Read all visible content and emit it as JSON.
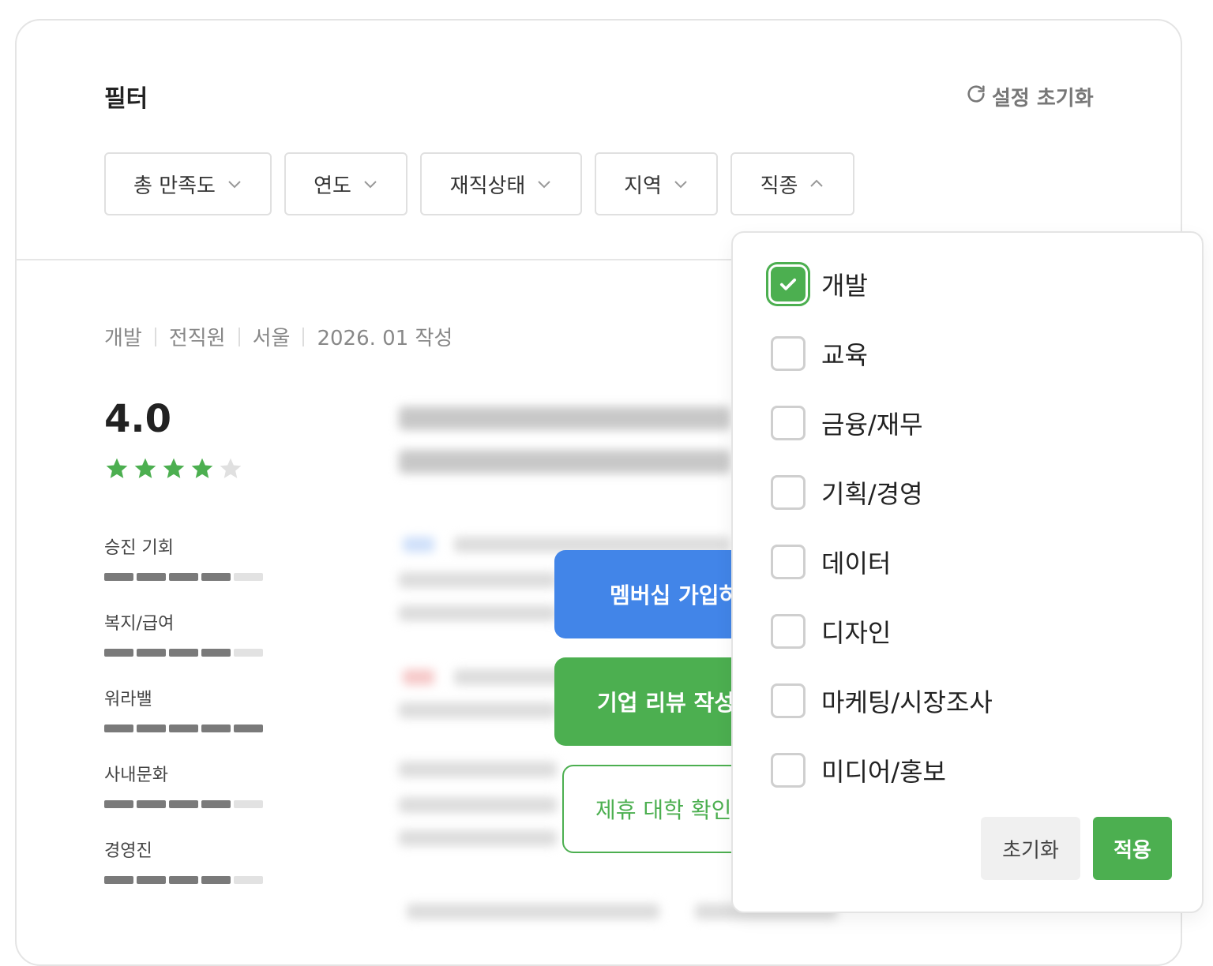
{
  "filter": {
    "title": "필터",
    "reset_label": "설정 초기화",
    "chips": [
      {
        "label": "총 만족도"
      },
      {
        "label": "연도"
      },
      {
        "label": "재직상태"
      },
      {
        "label": "지역"
      },
      {
        "label": "직종"
      }
    ]
  },
  "review": {
    "meta": [
      "개발",
      "전직원",
      "서울",
      "2026. 01 작성"
    ],
    "score": "4.0",
    "star_rating": 4,
    "ratings": [
      {
        "label": "승진 기회",
        "level": 4,
        "max": 5
      },
      {
        "label": "복지/급여",
        "level": 4,
        "max": 5
      },
      {
        "label": "워라밸",
        "level": 5,
        "max": 5
      },
      {
        "label": "사내문화",
        "level": 4,
        "max": 5
      },
      {
        "label": "경영진",
        "level": 4,
        "max": 5
      }
    ]
  },
  "cta": {
    "membership": "멤버십 가입하",
    "write_review": "기업 리뷰 작성",
    "partner_univ": "제휴 대학 확인"
  },
  "dropdown": {
    "options": [
      {
        "label": "개발",
        "checked": true
      },
      {
        "label": "교육",
        "checked": false
      },
      {
        "label": "금융/재무",
        "checked": false
      },
      {
        "label": "기획/경영",
        "checked": false
      },
      {
        "label": "데이터",
        "checked": false
      },
      {
        "label": "디자인",
        "checked": false
      },
      {
        "label": "마케팅/시장조사",
        "checked": false
      },
      {
        "label": "미디어/홍보",
        "checked": false
      }
    ],
    "reset_label": "초기화",
    "apply_label": "적용"
  },
  "colors": {
    "accent_green": "#4caf50",
    "accent_blue": "#4285e8"
  }
}
